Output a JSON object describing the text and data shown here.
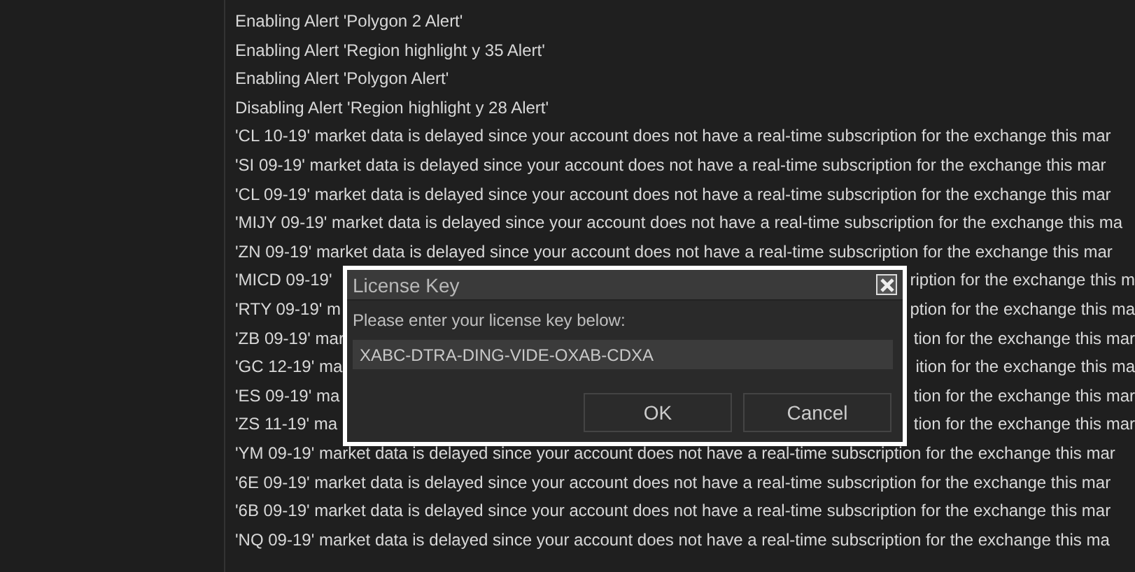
{
  "log": [
    {
      "text": "Enabling Alert 'Polygon 2 Alert'"
    },
    {
      "text": "Enabling Alert 'Region highlight y 35 Alert'"
    },
    {
      "text": "Enabling Alert 'Polygon Alert'"
    },
    {
      "text": "Disabling Alert 'Region highlight y 28 Alert'"
    },
    {
      "text": "'CL 10-19' market data is delayed since your account does not have a real-time subscription for the exchange this mar"
    },
    {
      "text": "'SI 09-19' market data is delayed since your account does not have a real-time subscription for the exchange this mar"
    },
    {
      "text": "'CL 09-19' market data is delayed since your account does not have a real-time subscription for the exchange this mar"
    },
    {
      "text": "'MIJY 09-19' market data is delayed since your account does not have a real-time subscription for the exchange this ma"
    },
    {
      "text": "'ZN 09-19' market data is delayed since your account does not have a real-time subscription for the exchange this mar"
    },
    {
      "text": "'MICD 09-19'",
      "text_after": "ription for the exchange this m"
    },
    {
      "text": "'RTY 09-19' m",
      "text_after": "ption for the exchange this ma"
    },
    {
      "text": "'ZB 09-19' mar",
      "text_after": "tion for the exchange this mar"
    },
    {
      "text": "'GC 12-19' ma",
      "text_after": "ition for the exchange this ma"
    },
    {
      "text": "'ES 09-19' ma",
      "text_after": "tion for the exchange this mar"
    },
    {
      "text": "'ZS 11-19' ma",
      "text_after": "tion for the exchange this mar"
    },
    {
      "text": "'YM 09-19' market data is delayed since your account does not have a real-time subscription for the exchange this mar"
    },
    {
      "text": "'6E 09-19' market data is delayed since your account does not have a real-time subscription for the exchange this mar"
    },
    {
      "text": "'6B 09-19' market data is delayed since your account does not have a real-time subscription for the exchange this mar"
    },
    {
      "text": "'NQ 09-19' market data is delayed since your account does not have a real-time subscription for the exchange this ma"
    }
  ],
  "dialog": {
    "title": "License Key",
    "prompt": "Please enter your license key below:",
    "value": "XABC-DTRA-DING-VIDE-OXAB-CDXA",
    "buttons": [
      "OK",
      "Cancel"
    ]
  }
}
